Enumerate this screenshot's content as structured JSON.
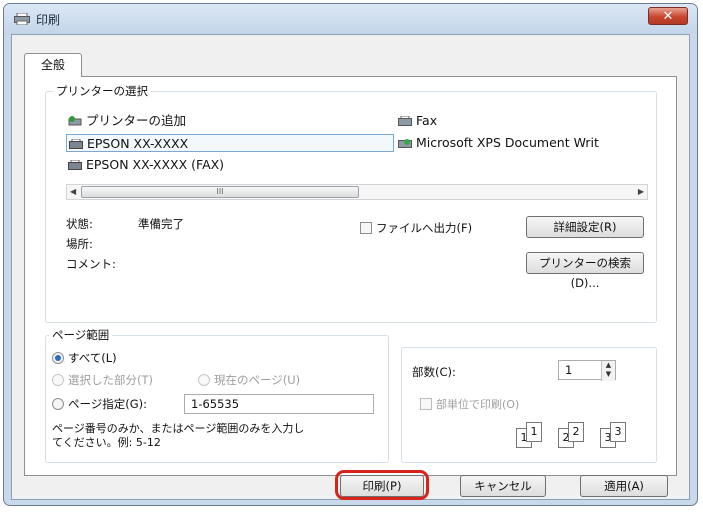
{
  "window": {
    "title": "印刷",
    "close_symbol": "✕"
  },
  "tabs": [
    {
      "label": "全般"
    }
  ],
  "printer_group": {
    "legend": "プリンターの選択",
    "printers": [
      {
        "name": "プリンターの追加",
        "icon": "add-printer-icon"
      },
      {
        "name": "Fax",
        "icon": "fax-printer-icon"
      },
      {
        "name": "EPSON XX-XXXX",
        "icon": "printer-icon",
        "selected": true
      },
      {
        "name": "Microsoft XPS Document Writ",
        "icon": "xps-printer-icon"
      },
      {
        "name": "EPSON XX-XXXX (FAX)",
        "icon": "printer-icon"
      }
    ],
    "status_label": "状態:",
    "status_value": "準備完了",
    "location_label": "場所:",
    "comment_label": "コメント:",
    "print_to_file": "ファイルへ出力(F)",
    "preferences_button": "詳細設定(R)",
    "find_printer_button": "プリンターの検索(D)...",
    "scroll_thumb_grip": "III"
  },
  "page_range_group": {
    "legend": "ページ範囲",
    "all": "すべて(L)",
    "selection": "選択した部分(T)",
    "current_page": "現在のページ(U)",
    "pages": "ページ指定(G):",
    "pages_value": "1-65535",
    "help_text_line1": "ページ番号のみか、またはページ範囲のみを入力し",
    "help_text_line2": "てください。例: 5-12",
    "selected_option": "all"
  },
  "copies_group": {
    "copies_label": "部数(C):",
    "copies_value": "1",
    "collate": "部単位で印刷(O)",
    "collate_pages": [
      [
        "1",
        "1"
      ],
      [
        "2",
        "2"
      ],
      [
        "3",
        "3"
      ]
    ]
  },
  "buttons": {
    "print": "印刷(P)",
    "cancel": "キャンセル",
    "apply": "適用(A)"
  },
  "colors": {
    "highlight": "#d7241b",
    "close_button": "#c8462f"
  }
}
